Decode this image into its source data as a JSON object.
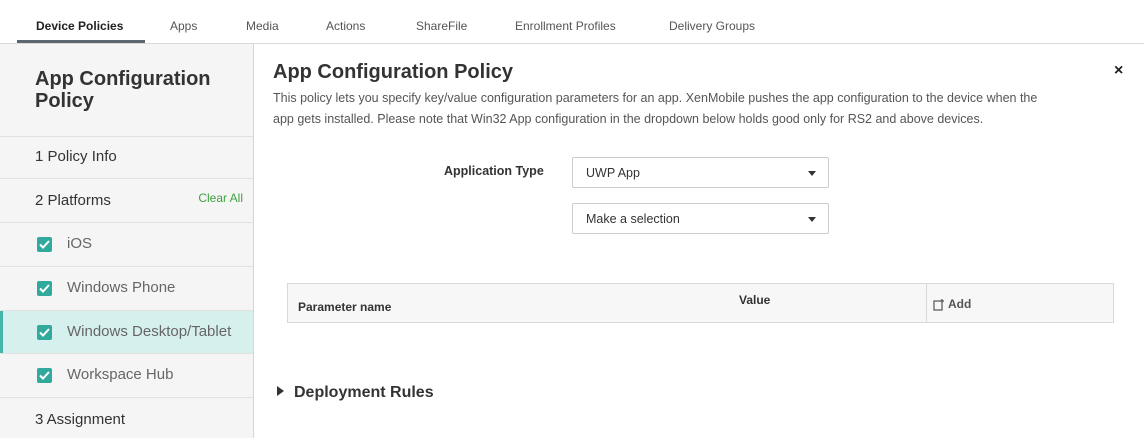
{
  "tabs": [
    {
      "label": "Device Policies",
      "active": true
    },
    {
      "label": "Apps"
    },
    {
      "label": "Media"
    },
    {
      "label": "Actions"
    },
    {
      "label": "ShareFile"
    },
    {
      "label": "Enrollment Profiles"
    },
    {
      "label": "Delivery Groups"
    }
  ],
  "sidebar": {
    "title": "App Configuration Policy",
    "steps": {
      "policy_info": "1  Policy Info",
      "platforms": "2  Platforms",
      "clear_all": "Clear All",
      "assignment": "3  Assignment"
    },
    "platforms": [
      {
        "label": "iOS",
        "checked": true
      },
      {
        "label": "Windows Phone",
        "checked": true
      },
      {
        "label": "Windows Desktop/Tablet",
        "checked": true,
        "selected": true
      },
      {
        "label": "Workspace Hub",
        "checked": true
      }
    ]
  },
  "main": {
    "title": "App Configuration Policy",
    "close": "×",
    "description": "This policy lets you specify key/value configuration parameters for an app. XenMobile pushes the app configuration to the device when the app gets installed. Please note that Win32 App configuration in the dropdown below holds good only for RS2 and above devices.",
    "application_type_label": "Application Type",
    "application_type_value": "UWP App",
    "app_select_value": "Make a selection",
    "table": {
      "col_param": "Parameter name",
      "col_value": "Value",
      "add_label": "Add"
    },
    "deployment_rules": "Deployment Rules"
  },
  "colors": {
    "accent_teal": "#31a99c",
    "selected_bg": "#d6f0ee",
    "clear_all_green": "#3ea23e"
  }
}
